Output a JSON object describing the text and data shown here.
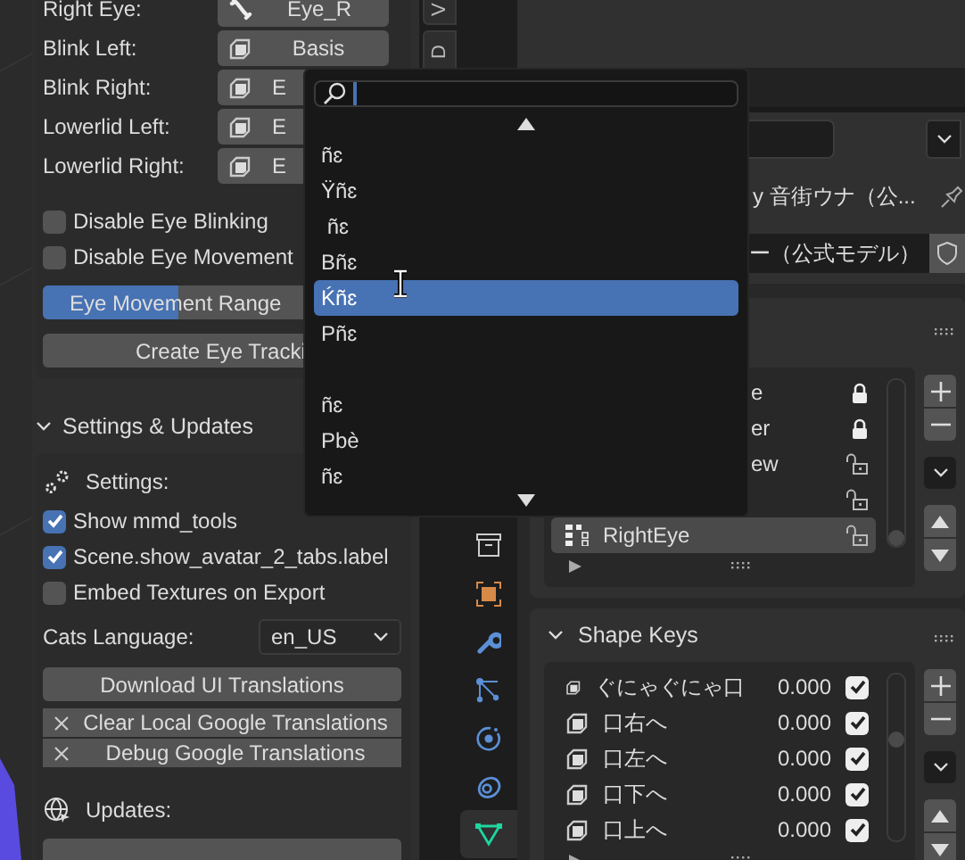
{
  "eye_panel": {
    "rows": [
      {
        "label": "Right Eye:",
        "value": "Eye_R"
      },
      {
        "label": "Blink Left:",
        "value": "Basis"
      },
      {
        "label": "Blink Right:",
        "value": "E"
      },
      {
        "label": "Lowerlid Left:",
        "value": "E"
      },
      {
        "label": "Lowerlid Right:",
        "value": "E"
      }
    ],
    "checkboxes": [
      {
        "label": "Disable Eye Blinking",
        "checked": false
      },
      {
        "label": "Disable Eye Movement",
        "checked": false
      }
    ],
    "slider": {
      "label": "Eye Movement Range",
      "level": 0.52
    },
    "button": "Create Eye Tracki"
  },
  "settings": {
    "title": "Settings & Updates",
    "settings_label": "Settings:",
    "checkboxes": [
      {
        "label": "Show mmd_tools",
        "checked": true
      },
      {
        "label": "Scene.show_avatar_2_tabs.label",
        "checked": true
      },
      {
        "label": "Embed Textures on Export",
        "checked": false
      }
    ],
    "language": {
      "label": "Cats Language:",
      "value": "en_US"
    },
    "download_button": "Download UI Translations",
    "translation_buttons": [
      "Clear Local Google Translations",
      "Debug Google Translations"
    ],
    "updates_label": "Updates:"
  },
  "side_tabs": [
    "V",
    "D"
  ],
  "property_tabs": [
    {
      "kind": "collection",
      "selected": false
    },
    {
      "kind": "object",
      "selected": false
    },
    {
      "kind": "modifier",
      "selected": false
    },
    {
      "kind": "particles",
      "selected": false
    },
    {
      "kind": "physics",
      "selected": false
    },
    {
      "kind": "constraint",
      "selected": false
    },
    {
      "kind": "mesh",
      "selected": true
    }
  ],
  "properties": {
    "object_name": "y 音街ウナ（公...",
    "data_name": "ー（公式モデル）",
    "groups": [
      {
        "name": "e",
        "locked": true,
        "selected": false
      },
      {
        "name": "er",
        "locked": true,
        "selected": false
      },
      {
        "name": "ew",
        "locked": false,
        "selected": false
      },
      {
        "locked": false,
        "selected": false
      },
      {
        "name": "RightEye",
        "locked": false,
        "selected": true
      }
    ]
  },
  "shape_keys": {
    "title": "Shape Keys",
    "keys": [
      {
        "name": "ぐにゃぐにゃ口",
        "value": "0.000",
        "enabled": true
      },
      {
        "name": "口右へ",
        "value": "0.000",
        "enabled": true
      },
      {
        "name": "口左へ",
        "value": "0.000",
        "enabled": true
      },
      {
        "name": "口下へ",
        "value": "0.000",
        "enabled": true
      },
      {
        "name": "口上へ",
        "value": "0.000",
        "enabled": true
      }
    ]
  },
  "popup": {
    "items": [
      {
        "kind": "item",
        "label": "ñɛ",
        "selected": false
      },
      {
        "kind": "item",
        "label": "Ÿñɛ",
        "selected": false
      },
      {
        "kind": "item",
        "label": " ñɛ",
        "selected": false
      },
      {
        "kind": "item",
        "label": "Bñɛ",
        "selected": false
      },
      {
        "kind": "item",
        "label": "Ḱñɛ",
        "selected": true
      },
      {
        "kind": "item",
        "label": "Pñɛ",
        "selected": false
      },
      {
        "kind": "spacer"
      },
      {
        "kind": "item",
        "label": "ñɛ",
        "selected": false
      },
      {
        "kind": "item",
        "label": "Pbè",
        "selected": false
      },
      {
        "kind": "item",
        "label": "ñɛ",
        "selected": false
      }
    ]
  }
}
